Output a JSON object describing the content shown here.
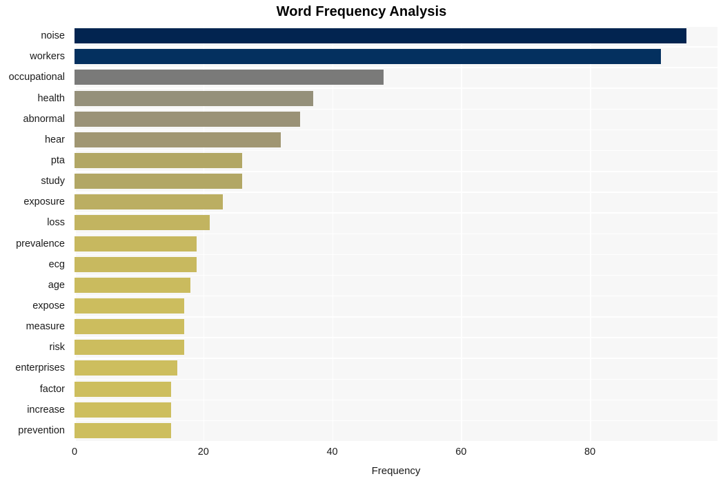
{
  "chart_data": {
    "type": "bar",
    "orientation": "horizontal",
    "title": "Word Frequency Analysis",
    "xlabel": "Frequency",
    "ylabel": "",
    "xlim": [
      0,
      99.8
    ],
    "ylim": [
      0,
      20
    ],
    "grid": true,
    "legend": null,
    "xticks": [
      0,
      20,
      40,
      60,
      80
    ],
    "xtick_labels": [
      "0",
      "20",
      "40",
      "60",
      "80"
    ],
    "categories": [
      "noise",
      "workers",
      "occupational",
      "health",
      "abnormal",
      "hear",
      "pta",
      "study",
      "exposure",
      "loss",
      "prevalence",
      "ecg",
      "age",
      "expose",
      "measure",
      "risk",
      "enterprises",
      "factor",
      "increase",
      "prevention"
    ],
    "values": [
      95,
      91,
      48,
      37,
      35,
      32,
      26,
      26,
      23,
      21,
      19,
      19,
      18,
      17,
      17,
      17,
      16,
      15,
      15,
      15
    ],
    "bar_colors": [
      "#022450",
      "#04305f",
      "#7a7a79",
      "#95907a",
      "#9a9277",
      "#a09672",
      "#b2a765",
      "#b2a765",
      "#bbae62",
      "#c2b460",
      "#c7b85f",
      "#c8b95f",
      "#cabb5e",
      "#ccbd5e",
      "#ccbd5e",
      "#ccbd5e",
      "#cdbe5e",
      "#cdbe5e",
      "#cdbe5e",
      "#cdbe5e"
    ],
    "plot_background": "#f7f7f7",
    "grid_color": "#ffffff",
    "figure_background": "#ffffff",
    "text_color": "#1a1a1a"
  }
}
